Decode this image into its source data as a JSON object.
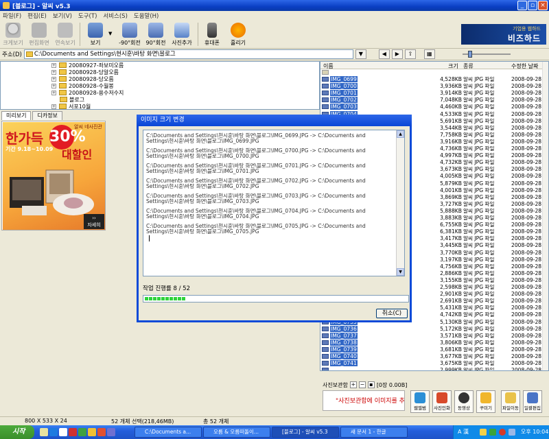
{
  "window": {
    "title": "[블로그] - 알씨 v5.3"
  },
  "menu": [
    "파일(F)",
    "편집(E)",
    "보기(V)",
    "도구(T)",
    "서비스(S)",
    "도움말(H)"
  ],
  "toolbar": [
    {
      "label": "크게보기",
      "icon": "magnifier-icon"
    },
    {
      "label": "편집화면",
      "icon": "edit-icon"
    },
    {
      "label": "연속보기",
      "icon": "slideshow-icon"
    },
    {
      "label": "보기",
      "icon": "view-icon"
    },
    {
      "label": "-90°회전",
      "icon": "rotate-left-icon"
    },
    {
      "label": "90°회전",
      "icon": "rotate-right-icon"
    },
    {
      "label": "사진추가",
      "icon": "add-photo-icon"
    },
    {
      "label": "휴대폰",
      "icon": "phone-icon"
    },
    {
      "label": "흘리기",
      "icon": "ucc-icon"
    }
  ],
  "banner": {
    "sub": "기업용 웹하드",
    "main": "비즈하드"
  },
  "address": {
    "label": "주소(D)",
    "path": "C:\\Documents and Settings\\현시훈\\바탕 화면\\블로그"
  },
  "tree": [
    {
      "label": "20080927-좌보미오름"
    },
    {
      "label": "20080928-당알오름"
    },
    {
      "label": "20080928-당오름"
    },
    {
      "label": "20080928-수월봉"
    },
    {
      "label": "20080928-용수저수지"
    },
    {
      "label": "블로그"
    },
    {
      "label": "서포10월"
    }
  ],
  "tabs": [
    "미리보기",
    "디카정보"
  ],
  "promo": {
    "t1": "한가득",
    "t30": "30%",
    "t2": "알씨 네사진관",
    "t3": "기간 9.18~10.09",
    "t4": "대할인",
    "more": "자세히"
  },
  "filelist": {
    "headers": {
      "name": "이름",
      "size": "크기",
      "type": "종류",
      "date": "수정한 날짜"
    },
    "rows": [
      {
        "name": "IMG_0699",
        "size": "4,528KB",
        "type": "알씨 JPG 파일",
        "date": "2008-09-28 오"
      },
      {
        "name": "IMG_0700",
        "size": "3,936KB",
        "type": "알씨 JPG 파일",
        "date": "2008-09-28 오"
      },
      {
        "name": "IMG_0701",
        "size": "3,914KB",
        "type": "알씨 JPG 파일",
        "date": "2008-09-28 오"
      },
      {
        "name": "IMG_0702",
        "size": "7,048KB",
        "type": "알씨 JPG 파일",
        "date": "2008-09-28 오"
      },
      {
        "name": "IMG_0703",
        "size": "4,460KB",
        "type": "알씨 JPG 파일",
        "date": "2008-09-28 오"
      },
      {
        "name": "IMG_0704",
        "size": "4,533KB",
        "type": "알씨 JPG 파일",
        "date": "2008-09-28 오"
      },
      {
        "name": "",
        "size": "5,691KB",
        "type": "알씨 JPG 파일",
        "date": "2008-09-28 오"
      },
      {
        "name": "",
        "size": "3,544KB",
        "type": "알씨 JPG 파일",
        "date": "2008-09-28 오"
      },
      {
        "name": "",
        "size": "7,758KB",
        "type": "알씨 JPG 파일",
        "date": "2008-09-28 오"
      },
      {
        "name": "",
        "size": "3,916KB",
        "type": "알씨 JPG 파일",
        "date": "2008-09-28 오"
      },
      {
        "name": "",
        "size": "4,736KB",
        "type": "알씨 JPG 파일",
        "date": "2008-09-28 오"
      },
      {
        "name": "",
        "size": "4,997KB",
        "type": "알씨 JPG 파일",
        "date": "2008-09-28 오"
      },
      {
        "name": "",
        "size": "4,732KB",
        "type": "알씨 JPG 파일",
        "date": "2008-09-28 오"
      },
      {
        "name": "",
        "size": "3,673KB",
        "type": "알씨 JPG 파일",
        "date": "2008-09-28 오"
      },
      {
        "name": "",
        "size": "4,005KB",
        "type": "알씨 JPG 파일",
        "date": "2008-09-28 오"
      },
      {
        "name": "",
        "size": "5,879KB",
        "type": "알씨 JPG 파일",
        "date": "2008-09-28 오"
      },
      {
        "name": "",
        "size": "4,001KB",
        "type": "알씨 JPG 파일",
        "date": "2008-09-28 오"
      },
      {
        "name": "",
        "size": "3,869KB",
        "type": "알씨 JPG 파일",
        "date": "2008-09-28 오"
      },
      {
        "name": "",
        "size": "3,727KB",
        "type": "알씨 JPG 파일",
        "date": "2008-09-28 오"
      },
      {
        "name": "",
        "size": "5,888KB",
        "type": "알씨 JPG 파일",
        "date": "2008-09-28 오"
      },
      {
        "name": "",
        "size": "3,883KB",
        "type": "알씨 JPG 파일",
        "date": "2008-09-28 오"
      },
      {
        "name": "",
        "size": "6,755KB",
        "type": "알씨 JPG 파일",
        "date": "2008-09-28 오"
      },
      {
        "name": "",
        "size": "6,381KB",
        "type": "알씨 JPG 파일",
        "date": "2008-09-28 오"
      },
      {
        "name": "",
        "size": "3,417KB",
        "type": "알씨 JPG 파일",
        "date": "2008-09-28 오"
      },
      {
        "name": "",
        "size": "3,445KB",
        "type": "알씨 JPG 파일",
        "date": "2008-09-28 오"
      },
      {
        "name": "",
        "size": "3,770KB",
        "type": "알씨 JPG 파일",
        "date": "2008-09-28 오"
      },
      {
        "name": "",
        "size": "3,197KB",
        "type": "알씨 JPG 파일",
        "date": "2008-09-28 오"
      },
      {
        "name": "",
        "size": "4,756KB",
        "type": "알씨 JPG 파일",
        "date": "2008-09-28 오"
      },
      {
        "name": "",
        "size": "2,886KB",
        "type": "알씨 JPG 파일",
        "date": "2008-09-28 오"
      },
      {
        "name": "",
        "size": "3,155KB",
        "type": "알씨 JPG 파일",
        "date": "2008-09-28 오"
      },
      {
        "name": "",
        "size": "2,598KB",
        "type": "알씨 JPG 파일",
        "date": "2008-09-28 오"
      },
      {
        "name": "",
        "size": "2,901KB",
        "type": "알씨 JPG 파일",
        "date": "2008-09-28 오"
      },
      {
        "name": "",
        "size": "2,691KB",
        "type": "알씨 JPG 파일",
        "date": "2008-09-28 오"
      },
      {
        "name": "",
        "size": "5,431KB",
        "type": "알씨 JPG 파일",
        "date": "2008-09-28 오"
      },
      {
        "name": "",
        "size": "4,742KB",
        "type": "알씨 JPG 파일",
        "date": "2008-09-28 오"
      },
      {
        "name": "IMG_0735",
        "size": "5,130KB",
        "type": "알씨 JPG 파일",
        "date": "2008-09-28 오"
      },
      {
        "name": "IMG_0736",
        "size": "5,172KB",
        "type": "알씨 JPG 파일",
        "date": "2008-09-28 오"
      },
      {
        "name": "IMG_0737",
        "size": "3,571KB",
        "type": "알씨 JPG 파일",
        "date": "2008-09-28 오"
      },
      {
        "name": "IMG_0738",
        "size": "3,806KB",
        "type": "알씨 JPG 파일",
        "date": "2008-09-28 오"
      },
      {
        "name": "IMG_0739",
        "size": "3,681KB",
        "type": "알씨 JPG 파일",
        "date": "2008-09-28 오"
      },
      {
        "name": "IMG_0740",
        "size": "3,677KB",
        "type": "알씨 JPG 파일",
        "date": "2008-09-28 오"
      },
      {
        "name": "IMG_0741",
        "size": "3,675KB",
        "type": "알씨 JPG 파일",
        "date": "2008-09-28 오"
      },
      {
        "name": "",
        "size": "2,999KB",
        "type": "알씨 JPG 파일",
        "date": "2008-09-28 오"
      }
    ]
  },
  "dialog": {
    "title": "이미지 크기 변경",
    "log": [
      "C:\\Documents and Settings\\현시훈\\바탕 화면\\블로그\\IMG_0699.JPG -> C:\\Documents and Settings\\현시훈\\바탕 화면\\블로그\\IMG_0699.JPG",
      "C:\\Documents and Settings\\현시훈\\바탕 화면\\블로그\\IMG_0700.JPG -> C:\\Documents and Settings\\현시훈\\바탕 화면\\블로그\\IMG_0700.JPG",
      "C:\\Documents and Settings\\현시훈\\바탕 화면\\블로그\\IMG_0701.JPG -> C:\\Documents and Settings\\현시훈\\바탕 화면\\블로그\\IMG_0701.JPG",
      "C:\\Documents and Settings\\현시훈\\바탕 화면\\블로그\\IMG_0702.JPG -> C:\\Documents and Settings\\현시훈\\바탕 화면\\블로그\\IMG_0702.JPG",
      "C:\\Documents and Settings\\현시훈\\바탕 화면\\블로그\\IMG_0703.JPG -> C:\\Documents and Settings\\현시훈\\바탕 화면\\블로그\\IMG_0703.JPG",
      "C:\\Documents and Settings\\현시훈\\바탕 화면\\블로그\\IMG_0704.JPG -> C:\\Documents and Settings\\현시훈\\바탕 화면\\블로그\\IMG_0704.JPG",
      "C:\\Documents and Settings\\현시훈\\바탕 화면\\블로그\\IMG_0705.JPG -> C:\\Documents and Settings\\현시훈\\바탕 화면\\블로그\\IMG_0705.JPG"
    ],
    "progress_label": "작업 진행률 8 / 52",
    "progress": 0.154,
    "cancel": "취소(C)"
  },
  "bottom_panel": {
    "title": "사진보관함",
    "count": "[0장 0.00B]",
    "message": "\"사진보관함에 이미지를 추",
    "buttons": [
      {
        "label": "웹앨범",
        "icon": "web-album-icon"
      },
      {
        "label": "사진인화",
        "icon": "print-icon"
      },
      {
        "label": "동영상",
        "icon": "film-icon"
      },
      {
        "label": "꾸미기",
        "icon": "decorate-icon"
      },
      {
        "label": "파일이동",
        "icon": "file-move-icon"
      },
      {
        "label": "일괄편집",
        "icon": "batch-edit-icon"
      }
    ]
  },
  "status": {
    "dims": "800 X 533 X 24",
    "selected": "52 개체 선택(218,46MB)",
    "total": "총 52 개체"
  },
  "taskbar": {
    "start": "시작",
    "tasks": [
      {
        "label": "C:\\Documents a..."
      },
      {
        "label": "오름 & 오름떠돌이..."
      },
      {
        "label": "[블로그] - 알씨 v5.3"
      },
      {
        "label": "새 문서 1 - 한글"
      }
    ],
    "time": "오후 10:04"
  },
  "colors": {
    "xp_blue": "#0a4ad8",
    "selection": "#3167c6",
    "progress": "#2ed33c"
  }
}
